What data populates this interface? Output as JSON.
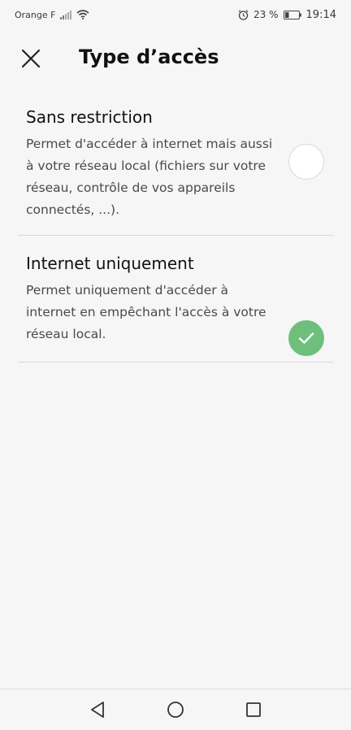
{
  "status_bar": {
    "carrier": "Orange F",
    "battery_percent": "23 %",
    "time": "19:14",
    "icons": [
      "signal-icon",
      "wifi-icon",
      "alarm-icon",
      "battery-icon"
    ]
  },
  "header": {
    "title": "Type d’accès",
    "close_icon": "close-icon"
  },
  "options": [
    {
      "title": "Sans restriction",
      "description": "Permet d'accéder à internet mais aussi à votre réseau local (fichiers sur votre réseau, contrôle de vos appareils connectés, ...).",
      "selected": false
    },
    {
      "title": "Internet uniquement",
      "description": "Permet uniquement d'accéder à internet en empêchant l'accès à votre réseau local.",
      "selected": true
    }
  ],
  "nav_bar": {
    "icons": [
      "back-icon",
      "home-icon",
      "recents-icon"
    ]
  },
  "colors": {
    "background": "#f6f6f6",
    "selected": "#6ebf7c",
    "divider": "#d9d9d9"
  }
}
